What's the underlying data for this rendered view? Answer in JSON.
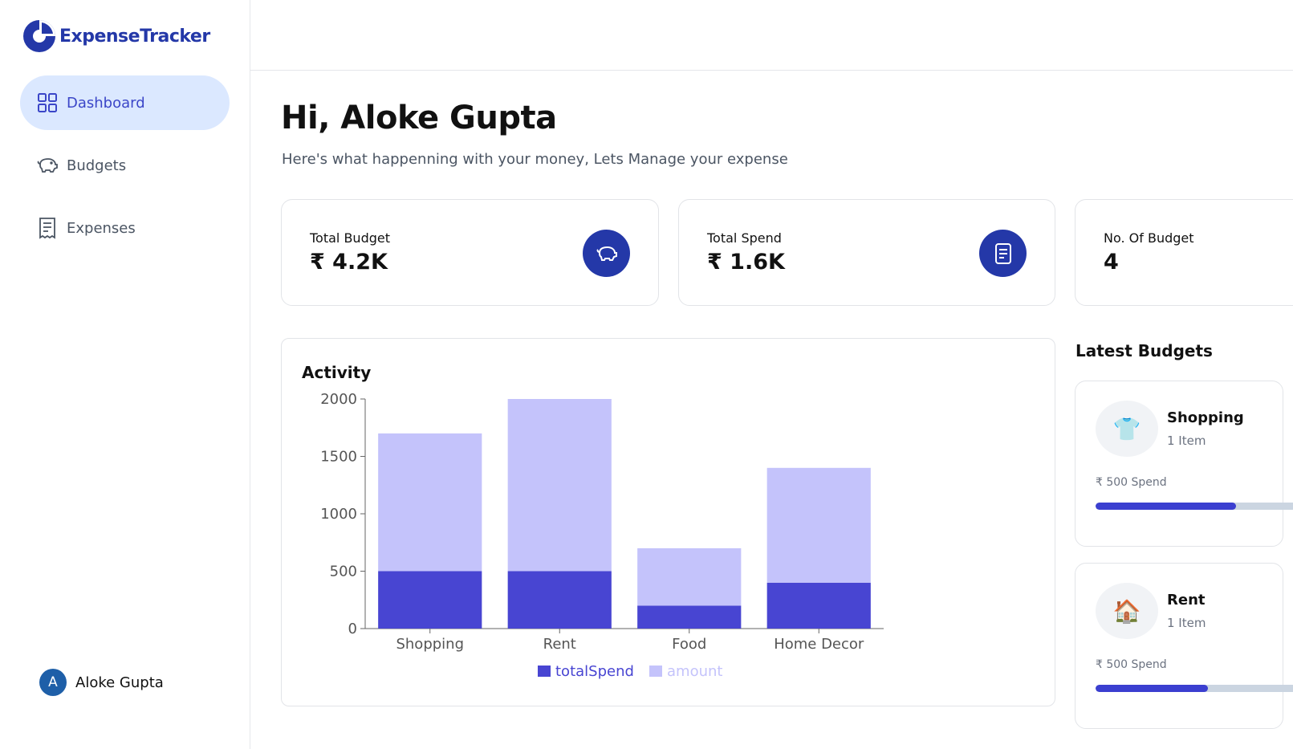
{
  "app": {
    "name": "ExpenseTracker"
  },
  "sidebar": {
    "items": [
      {
        "label": "Dashboard",
        "icon": "dashboard-grid-icon",
        "active": true
      },
      {
        "label": "Budgets",
        "icon": "piggy-bank-icon",
        "active": false
      },
      {
        "label": "Expenses",
        "icon": "receipt-icon",
        "active": false
      }
    ],
    "user": {
      "initial": "A",
      "name": "Aloke Gupta"
    }
  },
  "header": {
    "greeting": "Hi, Aloke Gupta",
    "subtitle": "Here's what happenning with your money, Lets Manage your expense"
  },
  "stats": [
    {
      "label": "Total Budget",
      "value": "₹ 4.2K",
      "icon": "piggy-bank-icon"
    },
    {
      "label": "Total Spend",
      "value": "₹ 1.6K",
      "icon": "receipt-icon"
    },
    {
      "label": "No. Of Budget",
      "value": "4",
      "icon": "wallet-icon"
    }
  ],
  "activity": {
    "title": "Activity"
  },
  "chart_data": {
    "type": "bar",
    "stacked": true,
    "categories": [
      "Shopping",
      "Rent",
      "Food",
      "Home Decor"
    ],
    "series": [
      {
        "name": "totalSpend",
        "values": [
          500,
          500,
          200,
          400
        ],
        "color": "#4845d2"
      },
      {
        "name": "amount",
        "values": [
          1200,
          1500,
          500,
          1000
        ],
        "color": "#c4c3fb"
      }
    ],
    "yticks": [
      0,
      500,
      1000,
      1500,
      2000
    ],
    "ylim": [
      0,
      2000
    ],
    "legend": "bottom-center"
  },
  "latest_budgets": {
    "title": "Latest Budgets",
    "items": [
      {
        "emoji": "👕",
        "name": "Shopping",
        "items": "1 Item",
        "spend": "₹ 500 Spend",
        "progress": 0.7
      },
      {
        "emoji": "🏠",
        "name": "Rent",
        "items": "1 Item",
        "spend": "₹ 500 Spend",
        "progress": 0.56
      }
    ]
  },
  "colors": {
    "brand": "#2438a8",
    "active_nav_bg": "#dbe8ff",
    "active_nav_text": "#3b46c8"
  }
}
